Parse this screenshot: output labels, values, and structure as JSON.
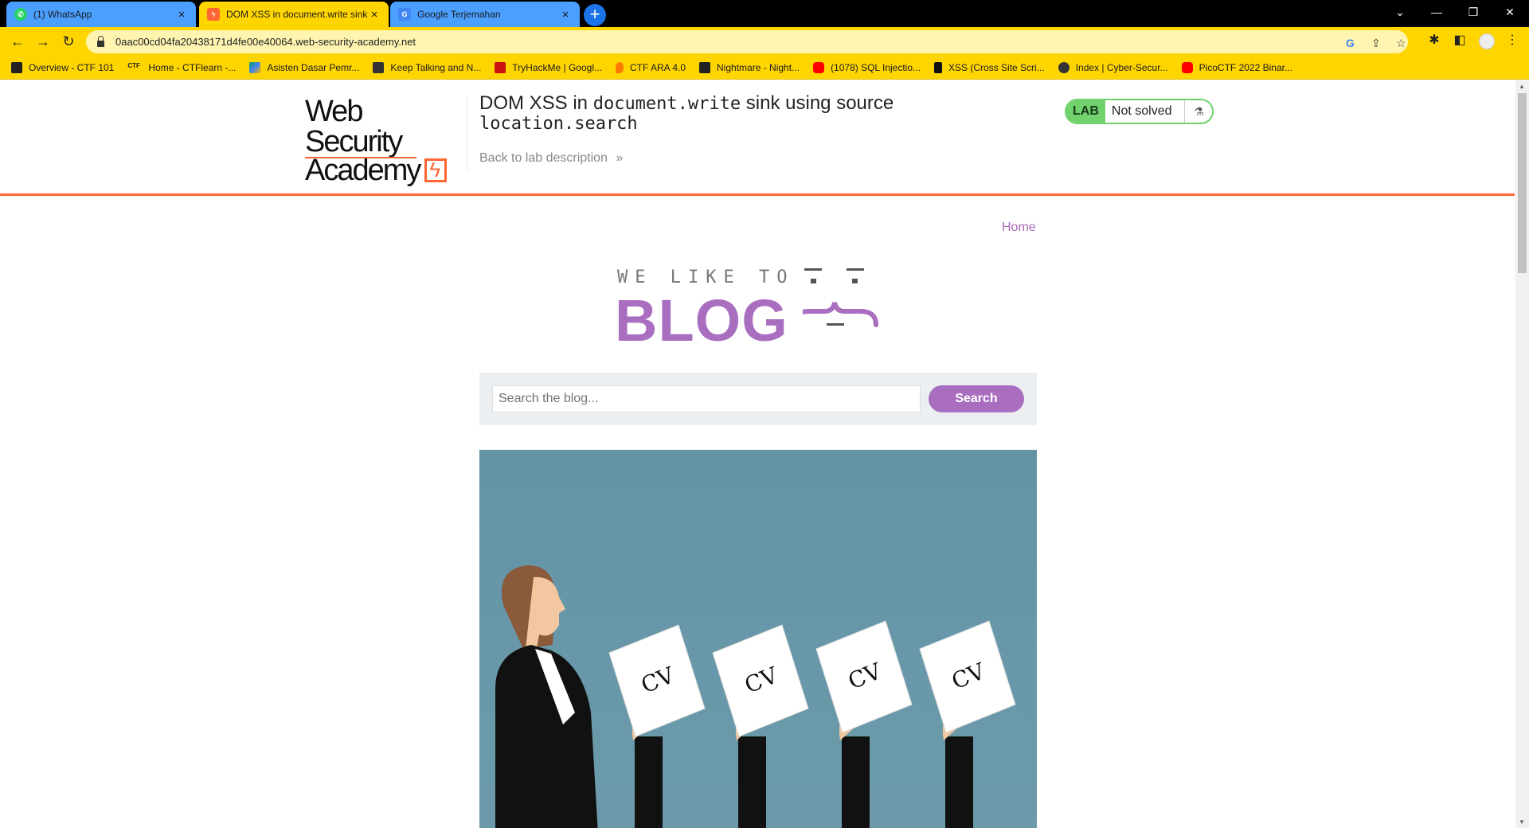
{
  "browser": {
    "tabs": [
      {
        "title": "(1) WhatsApp",
        "icon": "whatsapp-icon",
        "active": false
      },
      {
        "title": "DOM XSS in document.write sink",
        "icon": "burp-icon",
        "active": true
      },
      {
        "title": "Google Terjemahan",
        "icon": "google-translate-icon",
        "active": false
      }
    ],
    "new_tab": "+",
    "url": "0aac00cd04fa20438171d4fe00e40064.web-security-academy.net",
    "bookmarks": [
      {
        "label": "Overview - CTF 101",
        "icon": "book-icon"
      },
      {
        "label": "Home - CTFlearn -...",
        "icon": "ctf-icon"
      },
      {
        "label": "Asisten Dasar Pemr...",
        "icon": "drive-icon"
      },
      {
        "label": "Keep Talking and N...",
        "icon": "game-icon"
      },
      {
        "label": "TryHackMe | Googl...",
        "icon": "tryhackme-icon"
      },
      {
        "label": "CTF ARA 4.0",
        "icon": "flame-icon"
      },
      {
        "label": "Nightmare - Night...",
        "icon": "book-icon"
      },
      {
        "label": "(1078) SQL Injectio...",
        "icon": "youtube-icon"
      },
      {
        "label": "XSS (Cross Site Scri...",
        "icon": "doc-icon"
      },
      {
        "label": "Index | Cyber-Secur...",
        "icon": "globe-icon"
      },
      {
        "label": "PicoCTF 2022 Binar...",
        "icon": "youtube-icon"
      }
    ]
  },
  "header": {
    "logo_line1": "Web Security",
    "logo_line2": "Academy",
    "title_prefix": "DOM XSS in ",
    "title_code1": "document.write",
    "title_mid": " sink using source",
    "title_code2": "location.search",
    "back_link": "Back to lab description",
    "lab_badge": "LAB",
    "lab_status": "Not solved"
  },
  "nav": {
    "home": "Home"
  },
  "banner": {
    "we_like_to": "WE LIKE TO",
    "blog": "BLOG"
  },
  "search": {
    "placeholder": "Search the blog...",
    "button": "Search"
  },
  "hero": {
    "cv_label": "CV"
  },
  "colors": {
    "accent": "#a96ec0",
    "brand_orange": "#ff6633",
    "status_green": "#70d16d",
    "browser_theme": "#ffd500"
  }
}
